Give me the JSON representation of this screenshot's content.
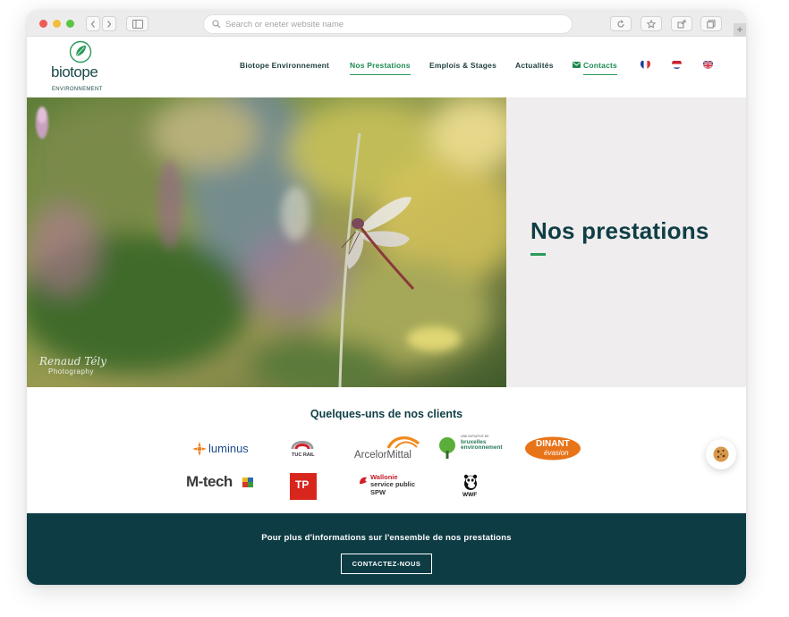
{
  "browser": {
    "address_placeholder": "Search or eneter website name",
    "new_tab_symbol": "+"
  },
  "header": {
    "logo_name": "biotope",
    "logo_subtitle": "ENVIRONNEMENT",
    "nav": [
      {
        "label": "Biotope Environnement",
        "active": false
      },
      {
        "label": "Nos Prestations",
        "active": true
      },
      {
        "label": "Emplois & Stages",
        "active": false
      },
      {
        "label": "Actualités",
        "active": false
      }
    ],
    "contacts_label": "Contacts",
    "languages": [
      "fr",
      "nl",
      "en"
    ]
  },
  "hero": {
    "title": "Nos prestations",
    "photo_credit_signature": "Renaud Tély",
    "photo_credit_subtitle": "Photography"
  },
  "clients": {
    "title": "Quelques-uns de nos clients",
    "logos": [
      {
        "name": "luminus",
        "text": "luminus"
      },
      {
        "name": "tuc-rail",
        "text": "TUC RAIL"
      },
      {
        "name": "arcelormittal",
        "text": "ArcelorMittal"
      },
      {
        "name": "bruxelles-environnement",
        "text": "bruxelles environnement",
        "tagline": "UNE INITIATIVE DE"
      },
      {
        "name": "dinant-evasion",
        "text": "DINANT",
        "subtext": "évasion"
      },
      {
        "name": "m-tech",
        "text": "M-tech"
      },
      {
        "name": "tp",
        "text": "TP"
      },
      {
        "name": "wallonie",
        "text": "Wallonie",
        "subtext": "service public",
        "code": "SPW"
      },
      {
        "name": "wwf",
        "text": "WWF"
      }
    ]
  },
  "footer": {
    "text": "Pour plus d'informations sur l'ensemble de nos prestations",
    "cta_label": "CONTACTEZ-NOUS"
  },
  "colors": {
    "brand_dark": "#0f3e45",
    "brand_green": "#2a9a5a",
    "hero_panel": "#efeded",
    "footer_bg": "#0e3c45"
  }
}
